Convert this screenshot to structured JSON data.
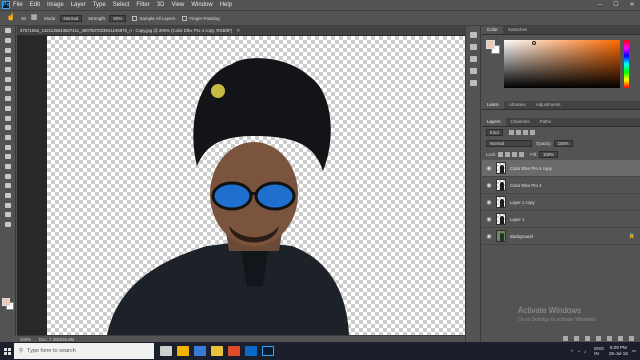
{
  "menubar": {
    "logo": "Ps",
    "items": [
      "File",
      "Edit",
      "Image",
      "Layer",
      "Type",
      "Select",
      "Filter",
      "3D",
      "View",
      "Window",
      "Help"
    ]
  },
  "options": {
    "mode_label": "Mode:",
    "mode_value": "Normal",
    "strength_label": "Strength:",
    "strength_value": "50%",
    "sample_all_layers": "Sample All Layers",
    "finger_painting": "Finger Painting",
    "brush_size": "30"
  },
  "document": {
    "tab_title": "37571552_1321135643607411_4907807023941246876_n - Copy.jpg @ 200% (Color Efex Pro 4 copy, RGB/8*)",
    "zoom": "200%",
    "doc_info": "Doc: 7.30M/36.8M"
  },
  "color_panel": {
    "tabs": [
      "Color",
      "Swatches"
    ],
    "active_tab": "Color",
    "fg_color": "#f0c8b4",
    "bg_color": "#ffffff"
  },
  "layers_panel": {
    "tabs": [
      "Layers",
      "Channels",
      "Paths"
    ],
    "active_tab": "Layers",
    "top_tabs": [
      "Learn",
      "Libraries",
      "Adjustments"
    ],
    "filter_kind": "Kind",
    "blend_mode": "Normal",
    "opacity_label": "Opacity:",
    "opacity_value": "100%",
    "lock_label": "Lock:",
    "fill_label": "Fill:",
    "fill_value": "100%",
    "layers": [
      {
        "name": "Color Efex Pro 4 copy",
        "selected": true
      },
      {
        "name": "Color Efex Pro 4",
        "selected": false
      },
      {
        "name": "Layer 1 copy",
        "selected": false
      },
      {
        "name": "Layer 1",
        "selected": false
      },
      {
        "name": "Background",
        "selected": false
      }
    ]
  },
  "watermark": {
    "title": "Activate Windows",
    "subtitle": "Go to Settings to activate Windows."
  },
  "taskbar": {
    "search_placeholder": "Type here to search",
    "lang": "ENG",
    "region": "IN",
    "time": "8:29 PM",
    "date": "26-Jul-18"
  },
  "icons": {
    "accent": "#31a8ff"
  }
}
